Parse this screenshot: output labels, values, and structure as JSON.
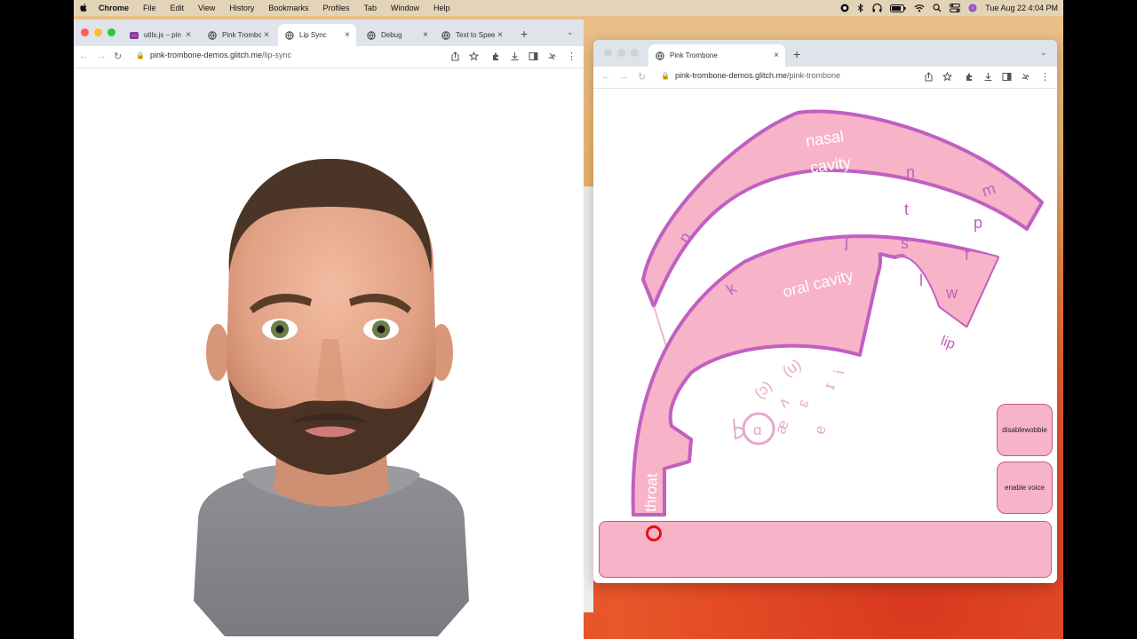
{
  "menubar": {
    "app_name": "Chrome",
    "items": [
      "File",
      "Edit",
      "View",
      "History",
      "Bookmarks",
      "Profiles",
      "Tab",
      "Window",
      "Help"
    ],
    "clock": "Tue Aug 22  4:04 PM"
  },
  "window_left": {
    "tabs": [
      {
        "label": "utils.js – pin",
        "active": false
      },
      {
        "label": "Pink Trombo",
        "active": false
      },
      {
        "label": "Lip Sync",
        "active": true
      },
      {
        "label": "Debug",
        "active": false
      },
      {
        "label": "Text to Spee",
        "active": false
      }
    ],
    "url_host": "pink-trombone-demos.glitch.me",
    "url_path": "/lip-sync"
  },
  "window_right": {
    "tab_label": "Pink Trombone",
    "url_host": "pink-trombone-demos.glitch.me",
    "url_path": "/pink-trombone",
    "trombone": {
      "labels": {
        "nasal": "nasal",
        "cavity_nasal": "cavity",
        "oral_cavity": "oral  cavity",
        "throat": "throat",
        "lip": "lip"
      },
      "consonants": [
        "n",
        "m",
        "t",
        "p",
        "n",
        "j",
        "s",
        "f",
        "k",
        "l",
        "w"
      ],
      "vowels": [
        "(u)",
        "(ɔ)",
        "ʌ",
        "ɑ",
        "æ",
        "ɛ",
        "ɪ",
        "i",
        "e"
      ],
      "buttons": {
        "wobble": "disablewobble",
        "voice": "enable voice"
      }
    }
  },
  "colors": {
    "tract_fill": "#f7b3c7",
    "tract_stroke": "#c060c0",
    "label_text": "#ffffff",
    "marker": "#e41010"
  }
}
